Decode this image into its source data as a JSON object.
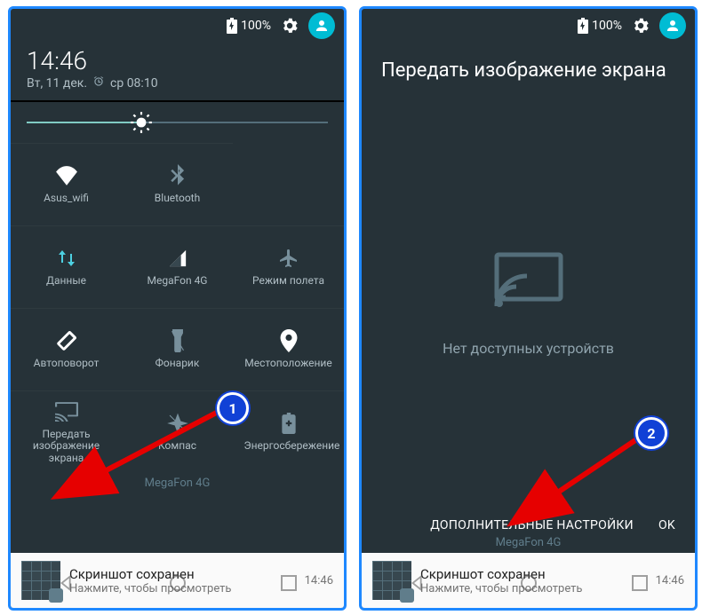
{
  "status": {
    "battery": "100%"
  },
  "clock": {
    "time": "14:46",
    "date": "Вт, 11 дек.",
    "alarm": "ср 08:10"
  },
  "brightness_percent": 38,
  "tiles": [
    {
      "label": "Asus_wifi"
    },
    {
      "label": "Bluetooth"
    },
    {
      "label": "Данные"
    },
    {
      "label": "MegaFon 4G"
    },
    {
      "label": "Режим полета"
    },
    {
      "label": "Автоповорот"
    },
    {
      "label": "Фонарик"
    },
    {
      "label": "Местоположение"
    },
    {
      "label": "Передать изображение экрана"
    },
    {
      "label": "Компас"
    },
    {
      "label": "Энергосбережение"
    }
  ],
  "carrier": "MegaFon 4G",
  "notification": {
    "title": "Скриншот сохранен",
    "subtitle": "Нажмите, чтобы просмотреть",
    "time": "14:46"
  },
  "cast": {
    "title": "Передать изображение экрана",
    "empty": "Нет доступных устройств",
    "settings": "ДОПОЛНИТЕЛЬНЫЕ НАСТРОЙКИ",
    "ok": "OK"
  },
  "annotations": {
    "badge1": "1",
    "badge2": "2"
  }
}
